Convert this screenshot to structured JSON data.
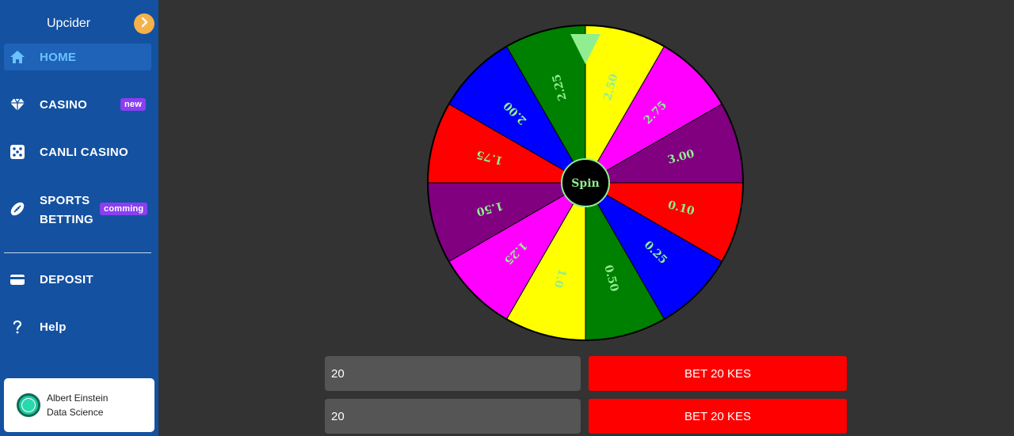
{
  "app": {
    "brand": "Upcider"
  },
  "sidebar": {
    "items": [
      {
        "label": "HOME",
        "icon": "home-icon",
        "active": true
      },
      {
        "label": "CASINO",
        "icon": "diamond-icon",
        "badge": "new"
      },
      {
        "label": "CANLI CASINO",
        "icon": "dice-icon"
      },
      {
        "label_line1": "SPORTS",
        "label_line2": "BETTING",
        "icon": "football-icon",
        "badge": "comming"
      },
      {
        "label": "DEPOSIT",
        "icon": "wallet-icon"
      },
      {
        "label": "Help",
        "icon": "question-icon"
      }
    ]
  },
  "profile": {
    "name": "Albert Einstein",
    "role": "Data Science"
  },
  "wheel": {
    "spin_label": "Spin",
    "segments": [
      {
        "label": "2.50",
        "color": "#ffff00",
        "text_color": "#90ee90"
      },
      {
        "label": "2.75",
        "color": "#ff00ff",
        "text_color": "#90ee90"
      },
      {
        "label": "3.00",
        "color": "#800080",
        "text_color": "#90ee90"
      },
      {
        "label": "0.10",
        "color": "#ff0000",
        "text_color": "#90ee90"
      },
      {
        "label": "0.25",
        "color": "#0000ff",
        "text_color": "#90ee90"
      },
      {
        "label": "0.50",
        "color": "#008000",
        "text_color": "#90ee90"
      },
      {
        "label": "1.0",
        "color": "#ffff00",
        "text_color": "#90ee90"
      },
      {
        "label": "1.25",
        "color": "#ff00ff",
        "text_color": "#90ee90"
      },
      {
        "label": "1.50",
        "color": "#800080",
        "text_color": "#90ee90"
      },
      {
        "label": "1.75",
        "color": "#ff0000",
        "text_color": "#90ee90"
      },
      {
        "label": "2.00",
        "color": "#0000ff",
        "text_color": "#90ee90"
      },
      {
        "label": "2.25",
        "color": "#008000",
        "text_color": "#90ee90"
      }
    ],
    "pointer_color": "#90ee90"
  },
  "bets": [
    {
      "amount": "20",
      "button_label": "BET 20 KES"
    },
    {
      "amount": "20",
      "button_label": "BET 20 KES"
    }
  ]
}
